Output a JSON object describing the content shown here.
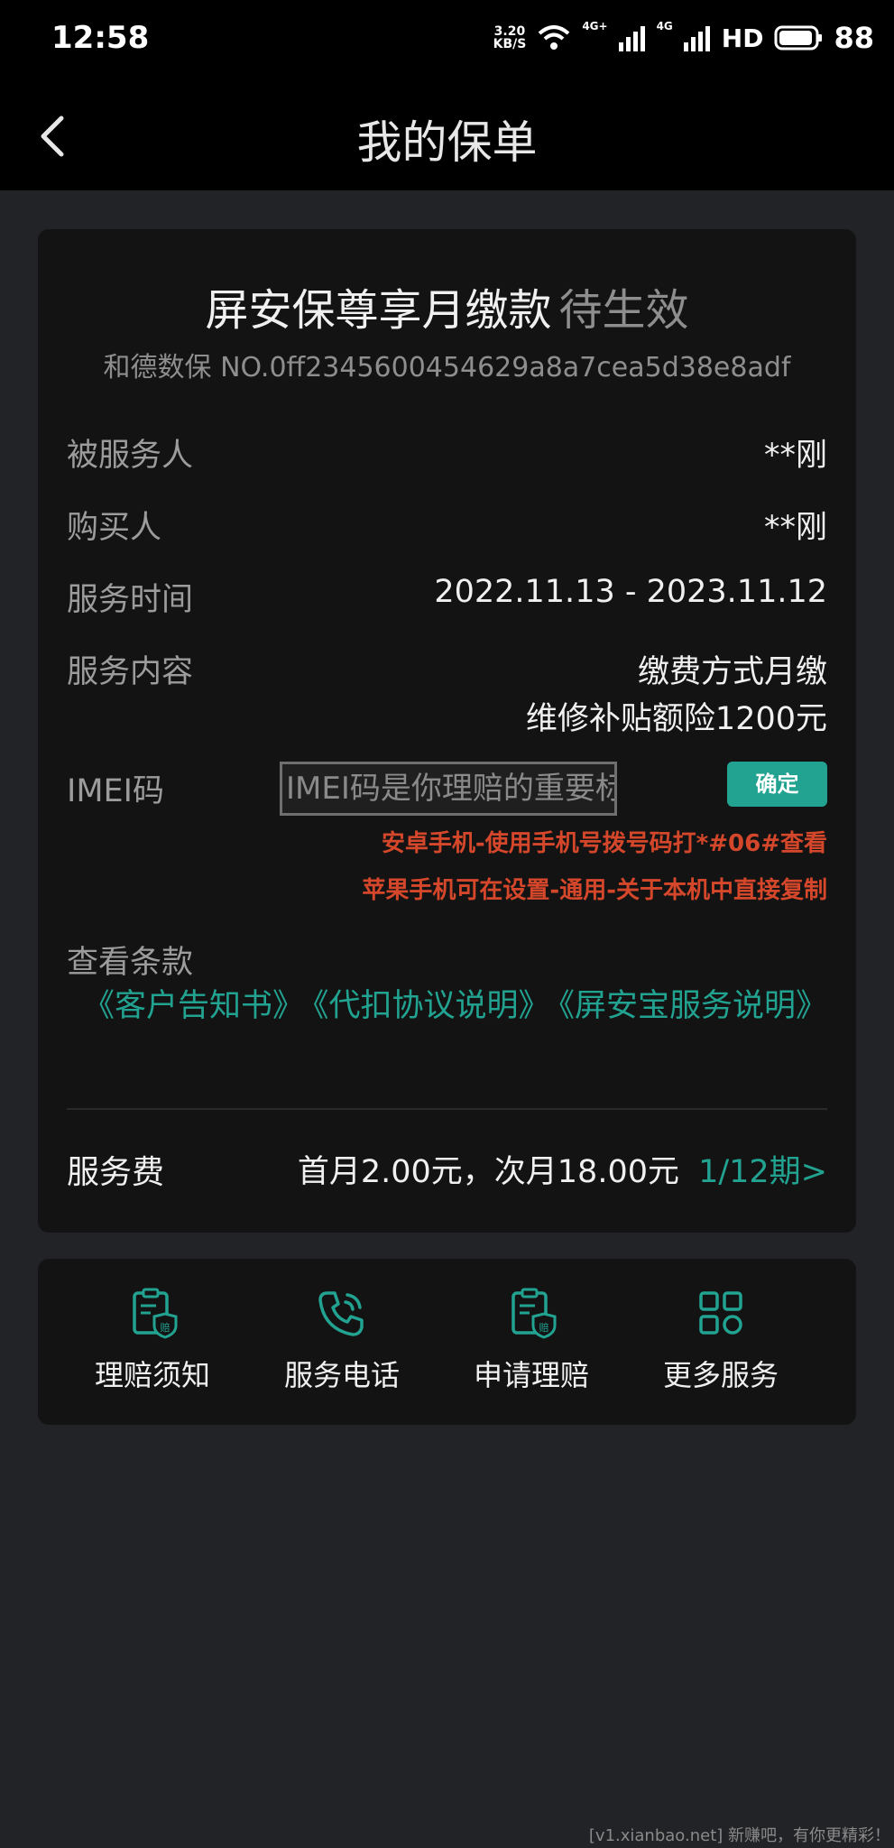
{
  "status_bar": {
    "time": "12:58",
    "speed_value": "3.20",
    "speed_unit": "KB/S",
    "network_label_1": "4G+",
    "network_label_2": "4G",
    "hd_label": "HD",
    "battery": "88"
  },
  "nav": {
    "title": "我的保单",
    "back_icon": "chevron-left-icon"
  },
  "policy": {
    "name": "屏安保尊享月缴款",
    "status": "待生效",
    "number": "和德数保 NO.0ff2345600454629a8a7cea5d38e8adf",
    "rows": [
      {
        "label": "被服务人",
        "value": "**刚"
      },
      {
        "label": "购买人",
        "value": "**刚"
      },
      {
        "label": "服务时间",
        "value": "2022.11.13 - 2023.11.12"
      }
    ],
    "content_label": "服务内容",
    "content_lines": [
      "缴费方式月缴",
      "维修补贴额险1200元"
    ],
    "imei": {
      "label": "IMEI码",
      "placeholder": "IMEI码是你理赔的重要标志",
      "confirm": "确定",
      "hint_android": "安卓手机-使用手机号拨号码打*#06#查看",
      "hint_apple": "苹果手机可在设置-通用-关于本机中直接复制"
    },
    "terms_label": "查看条款",
    "terms": [
      "《客户告知书》",
      "《代扣协议说明》",
      "《屏安宝服务说明》"
    ],
    "fee_label": "服务费",
    "fee_value": "首月2.00元，次月18.00元",
    "fee_period": "1/12期>"
  },
  "actions": [
    {
      "label": "理赔须知",
      "icon": "claim-notice-icon"
    },
    {
      "label": "服务电话",
      "icon": "phone-icon"
    },
    {
      "label": "申请理赔",
      "icon": "claim-apply-icon"
    },
    {
      "label": "更多服务",
      "icon": "grid-icon"
    }
  ],
  "watermark": "[v1.xianbao.net] 新赚吧，有你更精彩！",
  "colors": {
    "accent": "#22a391",
    "warning": "#d5472b",
    "card": "#131313",
    "background": "#222326"
  }
}
